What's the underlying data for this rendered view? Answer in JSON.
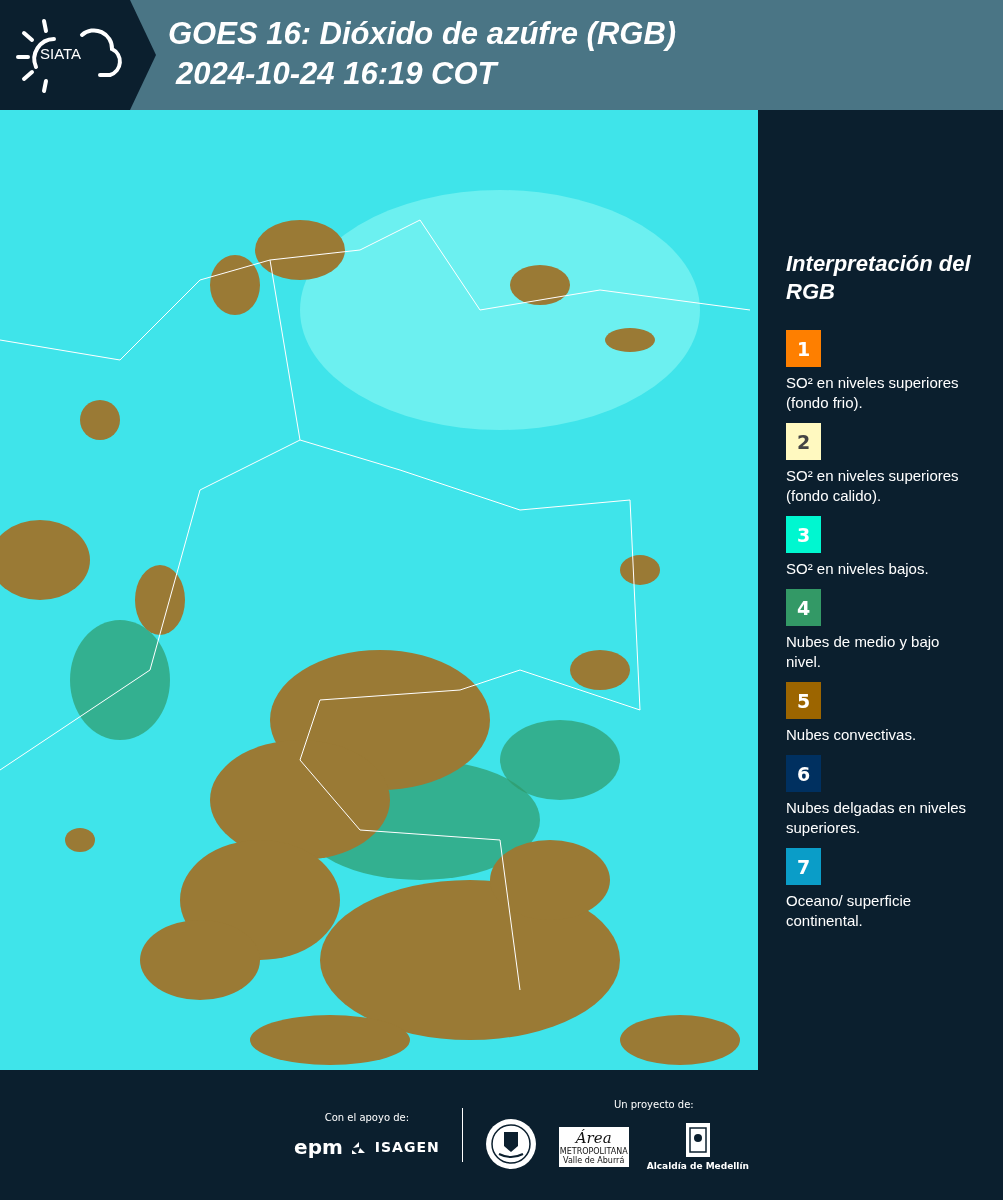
{
  "header": {
    "logo": "SIATA",
    "title": "GOES 16: Dióxido de azúfre (RGB)",
    "timestamp": "2024-10-24 16:19 COT"
  },
  "legend": {
    "title": "Interpretación del RGB",
    "items": [
      {
        "number": "1",
        "color": "#fe7f00",
        "text": "SO² en niveles superiores (fondo frio)."
      },
      {
        "number": "2",
        "color": "#fff9c0",
        "text": "SO² en niveles superiores (fondo calido)."
      },
      {
        "number": "3",
        "color": "#00f7d0",
        "text": "SO² en niveles bajos."
      },
      {
        "number": "4",
        "color": "#339966",
        "text": "Nubes de medio y bajo nivel."
      },
      {
        "number": "5",
        "color": "#9c6500",
        "text": "Nubes convectivas."
      },
      {
        "number": "6",
        "color": "#003060",
        "text": "Nubes delgadas en niveles superiores."
      },
      {
        "number": "7",
        "color": "#0a9dc8",
        "text": "Oceano/ superficie continental."
      }
    ]
  },
  "footer": {
    "support_label": "Con el apoyo de:",
    "support_logos": [
      "epm",
      "ISAGEN"
    ],
    "project_label": "Un proyecto de:",
    "area_logo": {
      "script": "Área",
      "line_1": "METROPOLITANA",
      "line_2": "Valle de Aburrá"
    },
    "city_logo": "Alcaldía de Medellín"
  }
}
